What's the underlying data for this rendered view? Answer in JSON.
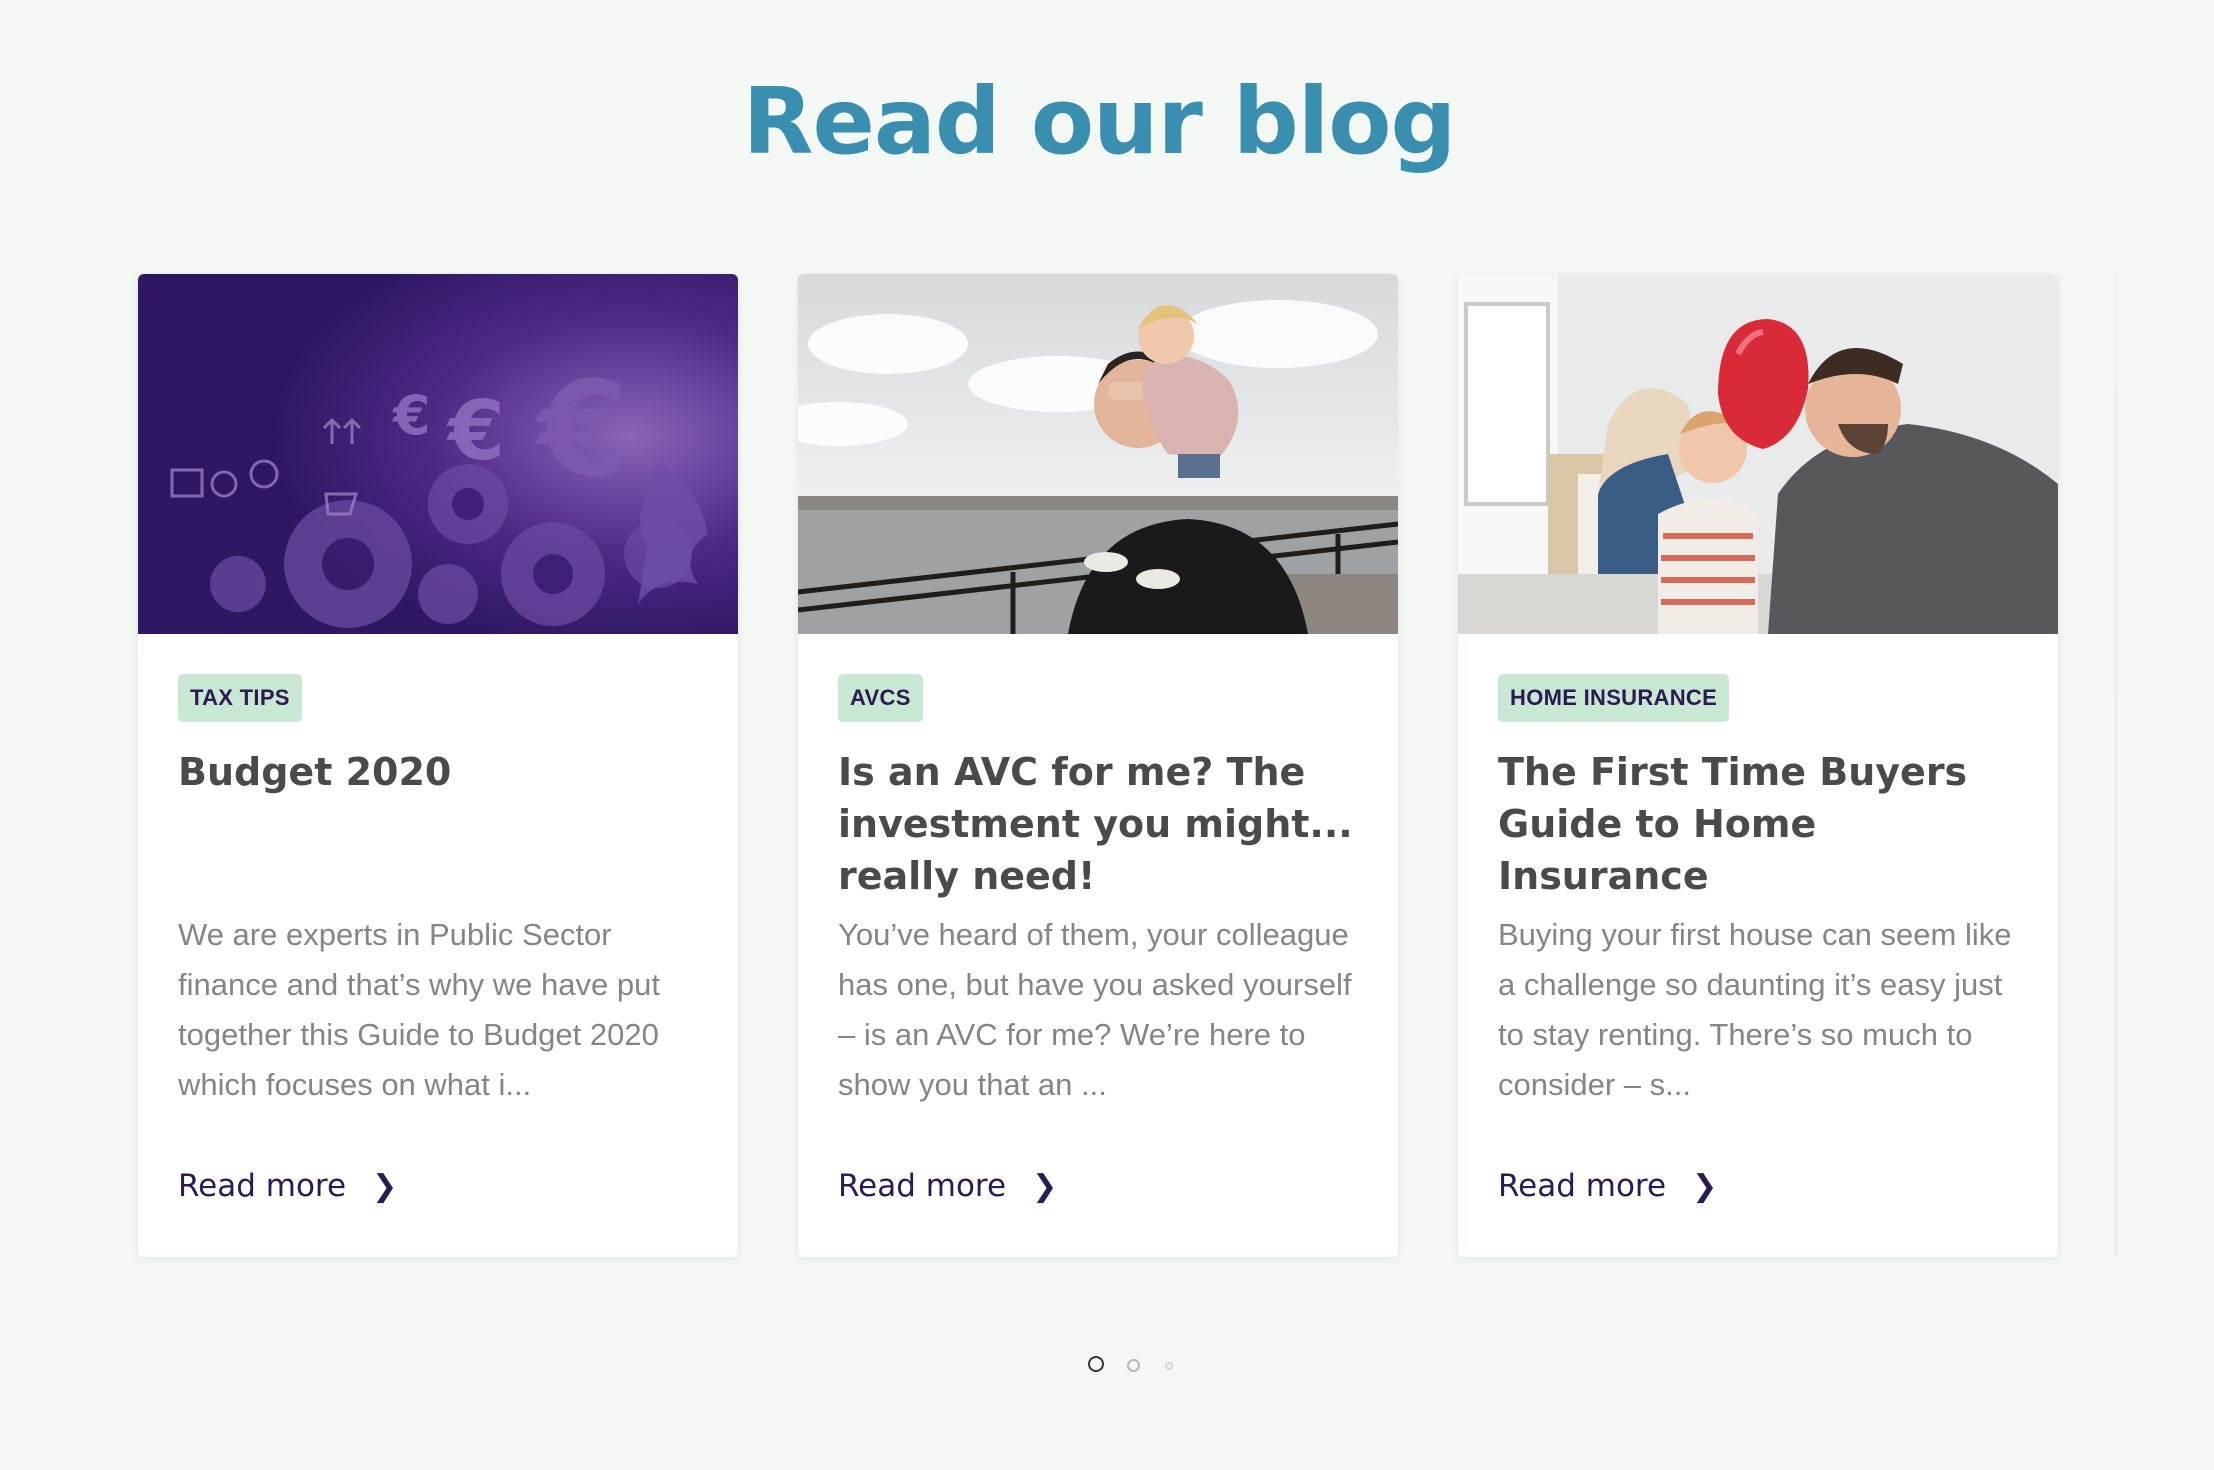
{
  "page": {
    "heading": "Read our blog"
  },
  "posts": [
    {
      "tag": "TAX TIPS",
      "title": "Budget 2020",
      "excerpt": "We are experts in Public Sector finance and that’s why we have put together this Guide to Budget 2020 which focuses on what i...",
      "read_more": "Read more",
      "image": "purple-finance-illustration"
    },
    {
      "tag": "AVCS",
      "title": "Is an AVC for me? The investment you might... really need!",
      "excerpt": "You’ve heard of them, your colleague has one, but have you asked yourself – is an AVC for me? We’re here to show you that an ...",
      "read_more": "Read more",
      "image": "father-daughter-waterfront-photo"
    },
    {
      "tag": "HOME INSURANCE",
      "title": "The First Time Buyers Guide to Home Insurance",
      "excerpt": "Buying your first house can seem like a challenge so daunting it’s easy just to stay renting. There’s so much to consider – s...",
      "read_more": "Read more",
      "image": "family-red-balloon-photo"
    }
  ],
  "carousel": {
    "active_index": 0,
    "count": 3
  },
  "colors": {
    "heading": "#3a8fb0",
    "tag_bg": "#c8e8d3",
    "link": "#2c1a52",
    "background": "#f3f8f5"
  },
  "icons": {
    "read_more": "chevron-right-icon"
  }
}
